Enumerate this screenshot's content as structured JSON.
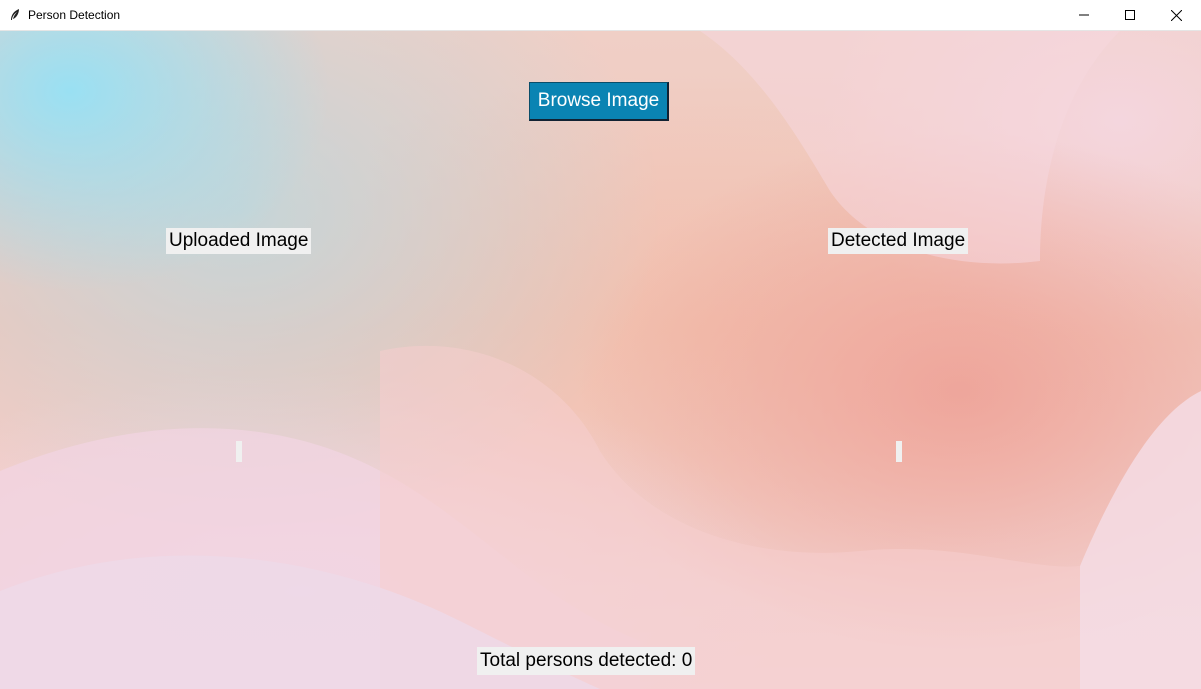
{
  "window": {
    "title": "Person Detection",
    "icon": "feather-icon",
    "controls": {
      "minimize_icon": "minimize-icon",
      "maximize_icon": "maximize-icon",
      "close_icon": "close-icon"
    }
  },
  "main": {
    "browse_button_label": "Browse Image",
    "uploaded_label": "Uploaded Image",
    "detected_label": "Detected Image",
    "total_label": "Total persons detected: 0"
  },
  "colors": {
    "button_bg": "#0a84b3",
    "button_text": "#ffffff",
    "label_bg": "#f0f0f0"
  }
}
